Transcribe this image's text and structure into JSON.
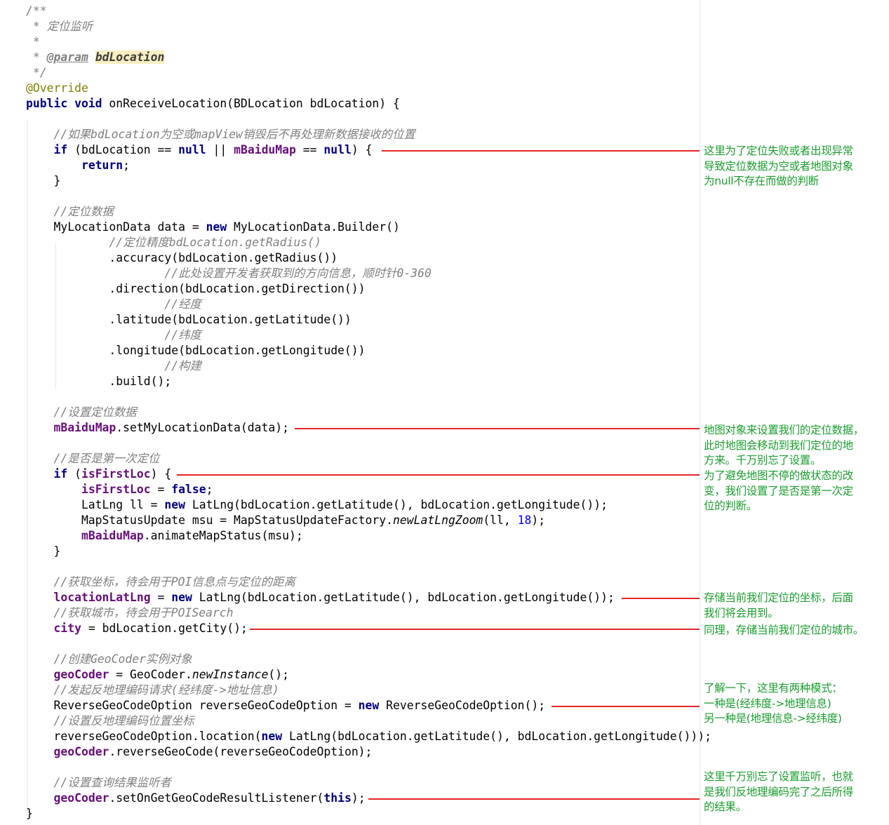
{
  "code_lines": [
    {
      "tokens": [
        {
          "t": "/**",
          "c": "cm"
        }
      ]
    },
    {
      "tokens": [
        {
          "t": " * 定位监听",
          "c": "cm"
        }
      ]
    },
    {
      "tokens": [
        {
          "t": " *",
          "c": "cm"
        }
      ]
    },
    {
      "tokens": [
        {
          "t": " * ",
          "c": "cm"
        },
        {
          "t": "@param",
          "c": "tag"
        },
        {
          "t": " ",
          "c": "cm"
        },
        {
          "t": "bdLocation",
          "c": "tagv"
        }
      ]
    },
    {
      "tokens": [
        {
          "t": " */",
          "c": "cm"
        }
      ]
    },
    {
      "tokens": [
        {
          "t": "@Override",
          "c": "ann"
        }
      ]
    },
    {
      "tokens": [
        {
          "t": "public void",
          "c": "kw"
        },
        {
          "t": " onReceiveLocation(BDLocation bdLocation) {",
          "c": "pl"
        }
      ]
    },
    {
      "tokens": []
    },
    {
      "tokens": [
        {
          "t": "    //如果bdLocation为空或mapView销毁后不再处理新数据接收的位置",
          "c": "cm"
        }
      ]
    },
    {
      "tokens": [
        {
          "t": "    ",
          "c": "pl"
        },
        {
          "t": "if",
          "c": "kw"
        },
        {
          "t": " (bdLocation == ",
          "c": "pl"
        },
        {
          "t": "null",
          "c": "kw"
        },
        {
          "t": " || ",
          "c": "pl"
        },
        {
          "t": "mBaiduMap",
          "c": "fld"
        },
        {
          "t": " == ",
          "c": "pl"
        },
        {
          "t": "null",
          "c": "kw"
        },
        {
          "t": ") {",
          "c": "pl"
        }
      ]
    },
    {
      "tokens": [
        {
          "t": "        ",
          "c": "pl"
        },
        {
          "t": "return",
          "c": "kw"
        },
        {
          "t": ";",
          "c": "pl"
        }
      ]
    },
    {
      "tokens": [
        {
          "t": "    }",
          "c": "pl"
        }
      ]
    },
    {
      "tokens": []
    },
    {
      "tokens": [
        {
          "t": "    //定位数据",
          "c": "cm"
        }
      ]
    },
    {
      "tokens": [
        {
          "t": "    MyLocationData data = ",
          "c": "pl"
        },
        {
          "t": "new",
          "c": "kw"
        },
        {
          "t": " MyLocationData.Builder()",
          "c": "pl"
        }
      ]
    },
    {
      "tokens": [
        {
          "t": "            //定位精度bdLocation.getRadius()",
          "c": "cm"
        }
      ]
    },
    {
      "tokens": [
        {
          "t": "            .accuracy(bdLocation.getRadius())",
          "c": "pl"
        }
      ]
    },
    {
      "tokens": [
        {
          "t": "                    //此处设置开发者获取到的方向信息，顺时针0-360",
          "c": "cm"
        }
      ]
    },
    {
      "tokens": [
        {
          "t": "            .direction(bdLocation.getDirection())",
          "c": "pl"
        }
      ]
    },
    {
      "tokens": [
        {
          "t": "                    //经度",
          "c": "cm"
        }
      ]
    },
    {
      "tokens": [
        {
          "t": "            .latitude(bdLocation.getLatitude())",
          "c": "pl"
        }
      ]
    },
    {
      "tokens": [
        {
          "t": "                    //纬度",
          "c": "cm"
        }
      ]
    },
    {
      "tokens": [
        {
          "t": "            .longitude(bdLocation.getLongitude())",
          "c": "pl"
        }
      ]
    },
    {
      "tokens": [
        {
          "t": "                    //构建",
          "c": "cm"
        }
      ]
    },
    {
      "tokens": [
        {
          "t": "            .build();",
          "c": "pl"
        }
      ]
    },
    {
      "tokens": []
    },
    {
      "tokens": [
        {
          "t": "    //设置定位数据",
          "c": "cm"
        }
      ]
    },
    {
      "tokens": [
        {
          "t": "    ",
          "c": "pl"
        },
        {
          "t": "mBaiduMap",
          "c": "fld"
        },
        {
          "t": ".setMyLocationData(data);",
          "c": "pl"
        }
      ]
    },
    {
      "tokens": []
    },
    {
      "tokens": [
        {
          "t": "    //是否是第一次定位",
          "c": "cm"
        }
      ]
    },
    {
      "tokens": [
        {
          "t": "    ",
          "c": "pl"
        },
        {
          "t": "if",
          "c": "kw"
        },
        {
          "t": " (",
          "c": "pl"
        },
        {
          "t": "isFirstLoc",
          "c": "fld"
        },
        {
          "t": ") {",
          "c": "pl"
        }
      ]
    },
    {
      "tokens": [
        {
          "t": "        ",
          "c": "pl"
        },
        {
          "t": "isFirstLoc",
          "c": "fld"
        },
        {
          "t": " = ",
          "c": "pl"
        },
        {
          "t": "false",
          "c": "kw"
        },
        {
          "t": ";",
          "c": "pl"
        }
      ]
    },
    {
      "tokens": [
        {
          "t": "        LatLng ll = ",
          "c": "pl"
        },
        {
          "t": "new",
          "c": "kw"
        },
        {
          "t": " LatLng(bdLocation.getLatitude(), bdLocation.getLongitude());",
          "c": "pl"
        }
      ]
    },
    {
      "tokens": [
        {
          "t": "        MapStatusUpdate msu = MapStatusUpdateFactory.",
          "c": "pl"
        },
        {
          "t": "newLatLngZoom",
          "c": "sm"
        },
        {
          "t": "(ll, ",
          "c": "pl"
        },
        {
          "t": "18",
          "c": "num"
        },
        {
          "t": ");",
          "c": "pl"
        }
      ]
    },
    {
      "tokens": [
        {
          "t": "        ",
          "c": "pl"
        },
        {
          "t": "mBaiduMap",
          "c": "fld"
        },
        {
          "t": ".animateMapStatus(msu);",
          "c": "pl"
        }
      ]
    },
    {
      "tokens": [
        {
          "t": "    }",
          "c": "pl"
        }
      ]
    },
    {
      "tokens": []
    },
    {
      "tokens": [
        {
          "t": "    //获取坐标，待会用于POI信息点与定位的距离",
          "c": "cm"
        }
      ]
    },
    {
      "tokens": [
        {
          "t": "    ",
          "c": "pl"
        },
        {
          "t": "locationLatLng",
          "c": "fld"
        },
        {
          "t": " = ",
          "c": "pl"
        },
        {
          "t": "new",
          "c": "kw"
        },
        {
          "t": " LatLng(bdLocation.getLatitude(), bdLocation.getLongitude());",
          "c": "pl"
        }
      ]
    },
    {
      "tokens": [
        {
          "t": "    //获取城市，待会用于POISearch",
          "c": "cm"
        }
      ]
    },
    {
      "tokens": [
        {
          "t": "    ",
          "c": "pl"
        },
        {
          "t": "city",
          "c": "fld"
        },
        {
          "t": " = bdLocation.getCity();",
          "c": "pl"
        }
      ]
    },
    {
      "tokens": []
    },
    {
      "tokens": [
        {
          "t": "    //创建GeoCoder实例对象",
          "c": "cm"
        }
      ]
    },
    {
      "tokens": [
        {
          "t": "    ",
          "c": "pl"
        },
        {
          "t": "geoCoder",
          "c": "fld"
        },
        {
          "t": " = GeoCoder.",
          "c": "pl"
        },
        {
          "t": "newInstance",
          "c": "sm"
        },
        {
          "t": "();",
          "c": "pl"
        }
      ]
    },
    {
      "tokens": [
        {
          "t": "    //发起反地理编码请求(经纬度->地址信息)",
          "c": "cm"
        }
      ]
    },
    {
      "tokens": [
        {
          "t": "    ReverseGeoCodeOption reverseGeoCodeOption = ",
          "c": "pl"
        },
        {
          "t": "new",
          "c": "kw"
        },
        {
          "t": " ReverseGeoCodeOption();",
          "c": "pl"
        }
      ]
    },
    {
      "tokens": [
        {
          "t": "    //设置反地理编码位置坐标",
          "c": "cm"
        }
      ]
    },
    {
      "tokens": [
        {
          "t": "    reverseGeoCodeOption.location(",
          "c": "pl"
        },
        {
          "t": "new",
          "c": "kw"
        },
        {
          "t": " LatLng(bdLocation.getLatitude(), bdLocation.getLongitude()));",
          "c": "pl"
        }
      ]
    },
    {
      "tokens": [
        {
          "t": "    ",
          "c": "pl"
        },
        {
          "t": "geoCoder",
          "c": "fld"
        },
        {
          "t": ".reverseGeoCode(reverseGeoCodeOption);",
          "c": "pl"
        }
      ]
    },
    {
      "tokens": []
    },
    {
      "tokens": [
        {
          "t": "    //设置查询结果监听者",
          "c": "cm"
        }
      ]
    },
    {
      "tokens": [
        {
          "t": "    ",
          "c": "pl"
        },
        {
          "t": "geoCoder",
          "c": "fld"
        },
        {
          "t": ".setOnGetGeoCodeResultListener(",
          "c": "pl"
        },
        {
          "t": "this",
          "c": "kw"
        },
        {
          "t": ");",
          "c": "pl"
        }
      ]
    },
    {
      "tokens": [
        {
          "t": "}",
          "c": "pl"
        }
      ]
    }
  ],
  "notes": [
    {
      "name": "note-null-check",
      "text": "这里为了定位失败或者出现异常\n导致定位数据为空或者地图对象\n为null不存在而做的判断"
    },
    {
      "name": "note-set-location-data",
      "text": "地图对象来设置我们的定位数据，\n此时地图会移动到我们定位的地\n方来。千万别忘了设置。"
    },
    {
      "name": "note-first-location",
      "text": "为了避免地图不停的做状态的改\n变，我们设置了是否是第一次定\n位的判断。"
    },
    {
      "name": "note-store-coordinate",
      "text": "存储当前我们定位的坐标，后面\n我们将会用到。"
    },
    {
      "name": "note-store-city",
      "text": "同理，存储当前我们定位的城市。"
    },
    {
      "name": "note-two-modes",
      "text": "了解一下，这里有两种模式：\n一种是(经纬度->地理信息)\n另一种是(地理信息->经纬度)"
    },
    {
      "name": "note-set-listener",
      "text": "这里千万别忘了设置监听，也就\n是我们反地理编码完了之后所得\n的结果。"
    }
  ],
  "colors": {
    "keyword": "#000080",
    "field": "#660e7a",
    "comment": "#808080",
    "annotation": "#808000",
    "number": "#0000ff",
    "param_highlight": "#f7eec1",
    "connector": "#e62626",
    "note_text": "#1a9e2e"
  }
}
